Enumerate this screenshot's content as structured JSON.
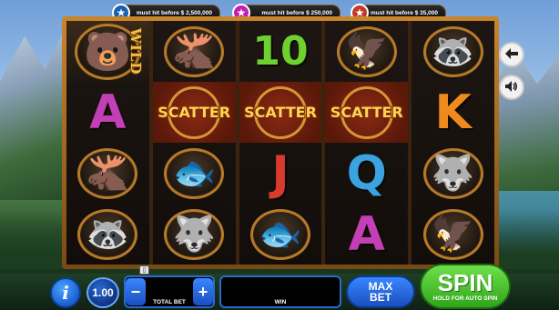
{
  "jackpots": [
    {
      "icon": "star-icon",
      "label": "must hit before $ 2,500,000",
      "color": "#2e86de"
    },
    {
      "icon": "star-icon",
      "label": "must hit before $ 250,000",
      "color": "#e04bd1"
    },
    {
      "icon": "star-icon",
      "label": "must hit before $ 35,000",
      "color": "#e67e22"
    }
  ],
  "reels": [
    {
      "symbols": [
        {
          "type": "wild",
          "animal": "bear",
          "emoji": "🐻",
          "label": "WILD"
        },
        {
          "type": "letter",
          "text": "A",
          "color": "#c23fb5"
        },
        {
          "type": "animal",
          "animal": "moose",
          "emoji": "🫎"
        },
        {
          "type": "animal",
          "animal": "raccoon",
          "emoji": "🦝"
        }
      ]
    },
    {
      "symbols": [
        {
          "type": "animal",
          "animal": "moose",
          "emoji": "🫎"
        },
        {
          "type": "scatter",
          "text": "SCATTER"
        },
        {
          "type": "animal",
          "animal": "salmon",
          "emoji": "🐟"
        },
        {
          "type": "animal",
          "animal": "wolf",
          "emoji": "🐺"
        }
      ]
    },
    {
      "symbols": [
        {
          "type": "number",
          "text": "10",
          "color": "#6fd12f"
        },
        {
          "type": "scatter",
          "text": "SCATTER"
        },
        {
          "type": "letter",
          "text": "J",
          "color": "#d83b2e"
        },
        {
          "type": "animal",
          "animal": "salmon",
          "emoji": "🐟"
        }
      ]
    },
    {
      "symbols": [
        {
          "type": "animal",
          "animal": "eagle",
          "emoji": "🦅"
        },
        {
          "type": "scatter",
          "text": "SCATTER"
        },
        {
          "type": "letter",
          "text": "Q",
          "color": "#3aa3e0"
        },
        {
          "type": "letter",
          "text": "A",
          "color": "#c23fb5"
        }
      ]
    },
    {
      "symbols": [
        {
          "type": "animal",
          "animal": "raccoon",
          "emoji": "🦝"
        },
        {
          "type": "letter",
          "text": "K",
          "color": "#f08a1c"
        },
        {
          "type": "animal",
          "animal": "wolf",
          "emoji": "🐺"
        },
        {
          "type": "animal",
          "animal": "eagle",
          "emoji": "🦅"
        }
      ]
    }
  ],
  "side": {
    "back_icon": "arrow-left-icon",
    "sound_icon": "speaker-icon"
  },
  "controls": {
    "info_label": "i",
    "bet_value": "1.00",
    "minus_label": "−",
    "plus_label": "+",
    "total_bet_label": "TOTAL BET",
    "total_bet_value": "",
    "win_label": "WIN",
    "win_value": "",
    "max_bet_line1": "MAX",
    "max_bet_line2": "BET",
    "spin_label": "SPIN",
    "spin_sub": "HOLD FOR AUTO SPIN"
  }
}
